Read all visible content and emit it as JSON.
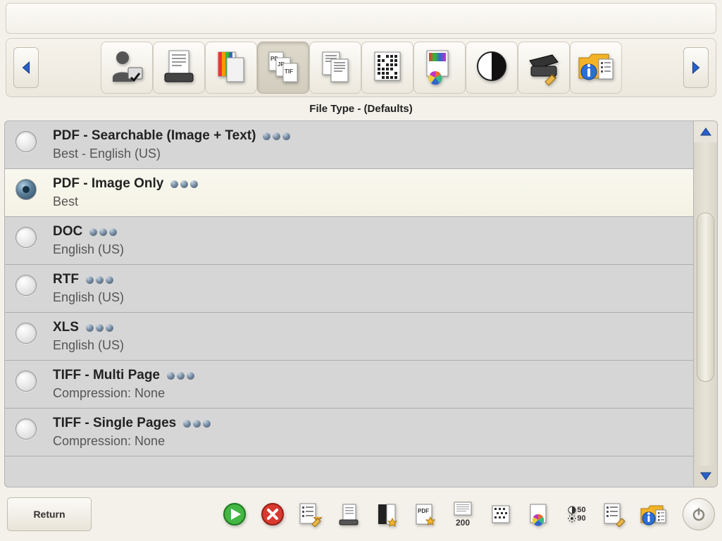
{
  "section_title": "File Type - (Defaults)",
  "toolbar": {
    "prev_aria": "Previous",
    "next_aria": "Next",
    "items": [
      {
        "name": "user-settings-icon"
      },
      {
        "name": "scanner-icon"
      },
      {
        "name": "color-pages-icon"
      },
      {
        "name": "file-type-icon",
        "active": true
      },
      {
        "name": "pages-icon"
      },
      {
        "name": "pattern-icon"
      },
      {
        "name": "color-profile-icon"
      },
      {
        "name": "contrast-icon"
      },
      {
        "name": "scanner-config-icon"
      },
      {
        "name": "info-folder-icon"
      }
    ]
  },
  "list": [
    {
      "title": "PDF - Searchable (Image + Text)",
      "sub": "Best - English (US)",
      "has_dots": true,
      "selected": false
    },
    {
      "title": "PDF - Image Only",
      "sub": "Best",
      "has_dots": true,
      "selected": true
    },
    {
      "title": "DOC",
      "sub": "English (US)",
      "has_dots": true,
      "selected": false
    },
    {
      "title": "RTF",
      "sub": "English (US)",
      "has_dots": true,
      "selected": false
    },
    {
      "title": "XLS",
      "sub": "English (US)",
      "has_dots": true,
      "selected": false
    },
    {
      "title": "TIFF - Multi Page",
      "sub": "Compression: None",
      "has_dots": true,
      "selected": false
    },
    {
      "title": "TIFF - Single Pages",
      "sub": "Compression: None",
      "has_dots": true,
      "selected": false
    }
  ],
  "bottom": {
    "return_label": "Return",
    "dpi_top": "50",
    "dpi_bot": "90",
    "resolution": "200"
  }
}
